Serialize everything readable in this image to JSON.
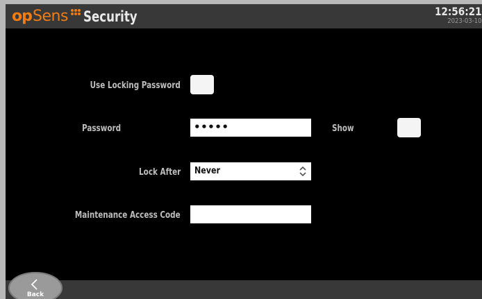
{
  "header": {
    "logo_text_a": "op",
    "logo_text_b": "Sens",
    "title": "Security",
    "time": "12:56:21",
    "date": "2023-03-10"
  },
  "form": {
    "use_locking_password_label": "Use Locking Password",
    "use_locking_password_checked": false,
    "password_label": "Password",
    "password_value": "•••••",
    "show_label": "Show",
    "show_checked": false,
    "lock_after_label": "Lock After",
    "lock_after_value": "Never",
    "maintenance_label": "Maintenance Access Code",
    "maintenance_value": ""
  },
  "footer": {
    "back_label": "Back"
  },
  "colors": {
    "brand": "#f07c14",
    "bar": "#383838",
    "background": "#000000"
  },
  "icons": {
    "select": "up-down-chevron-icon",
    "back": "chevron-left-icon"
  }
}
